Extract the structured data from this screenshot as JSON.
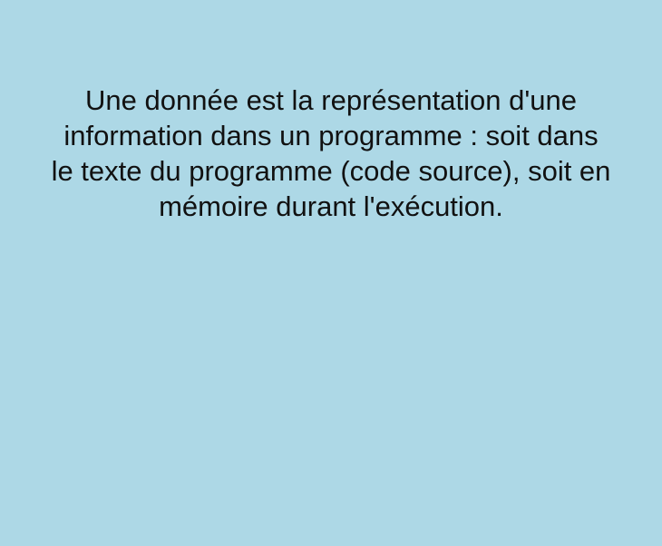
{
  "card": {
    "background_color": "#add8e6",
    "text_color": "#111111",
    "definition_text": "Une donnée est la représentation d'une information dans un programme : soit dans le texte du programme (code source), soit en mémoire durant l'exécution."
  }
}
